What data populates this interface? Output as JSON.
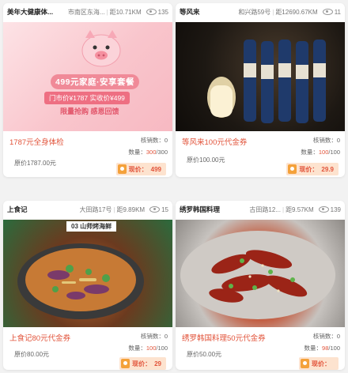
{
  "cards": [
    {
      "shop": "美年大健康体...",
      "address": "市南区东海...",
      "distance": "距10.71KM",
      "views": "135",
      "image": {
        "type": "promo",
        "promo_title": "499元家庭·安享套餐",
        "promo_prices": "门市价¥1787  实收价¥499",
        "promo_slogan": "限量抢购 感恩回馈"
      },
      "title": "1787元全身体检",
      "sold_label": "核销数：",
      "sold_value": "0",
      "qty_label": "数量：",
      "qty_current": "300",
      "qty_total": "/300",
      "original_price": "原价1787.00元",
      "current_label": "现价：",
      "current_value": "499"
    },
    {
      "shop": "等风来",
      "address": "和兴路59号",
      "distance": "距12690.67KM",
      "views": "11",
      "image": {
        "type": "photo",
        "subject": "bar-beer-bottles"
      },
      "title": "等风来100元代金券",
      "sold_label": "核销数：",
      "sold_value": "0",
      "qty_label": "数量：",
      "qty_current": "100",
      "qty_total": "/100",
      "original_price": "原价100.00元",
      "current_label": "现价：",
      "current_value": "29.9"
    },
    {
      "shop": "上食记",
      "address": "大田路17号",
      "distance": "距9.89KM",
      "views": "15",
      "image": {
        "type": "photo",
        "subject": "seafood-pot",
        "mark": "03 山师烤海鲜"
      },
      "title": "上食记80元代金券",
      "sold_label": "核销数：",
      "sold_value": "0",
      "qty_label": "数量：",
      "qty_current": "100",
      "qty_total": "/100",
      "original_price": "原价80.00元",
      "current_label": "现价：",
      "current_value": "29"
    },
    {
      "shop": "绣罗韩国料理",
      "address": "古田路12...",
      "distance": "距9.57KM",
      "views": "139",
      "image": {
        "type": "photo",
        "subject": "korean-spicy-dish"
      },
      "title": "绣罗韩国料理50元代金券",
      "sold_label": "核销数：",
      "sold_value": "0",
      "qty_label": "数量：",
      "qty_current": "98",
      "qty_total": "/100",
      "original_price": "原价50.00元",
      "current_label": "现价：",
      "current_value": ""
    }
  ],
  "colors": {
    "accent": "#e2543b",
    "price_bg": "#fde3cf",
    "tag": "#f4a13a"
  }
}
